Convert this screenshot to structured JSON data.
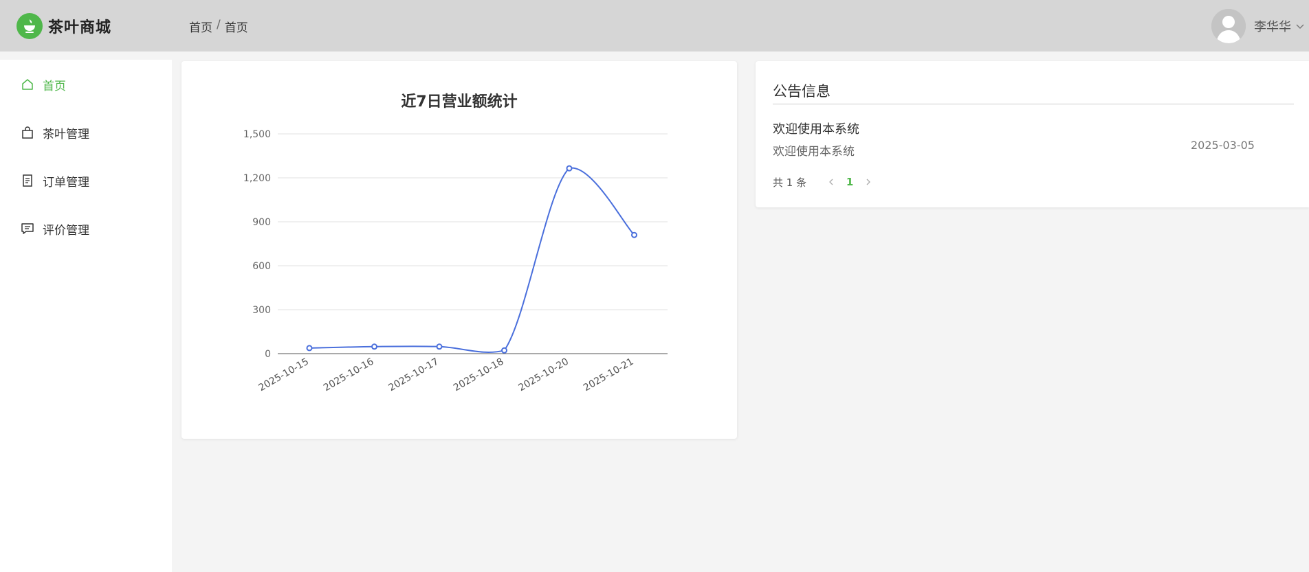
{
  "app": {
    "title": "茶叶商城",
    "accent_color": "#4fb74a",
    "logo_icon": "teacup-icon"
  },
  "header": {
    "breadcrumb": [
      "首页",
      "首页"
    ],
    "breadcrumb_separator": "/",
    "user": {
      "name": "李华华",
      "avatar_icon": "user-avatar-icon",
      "dropdown_icon": "chevron-down-icon"
    }
  },
  "sidebar": {
    "items": [
      {
        "label": "首页",
        "icon": "home-icon",
        "active": true
      },
      {
        "label": "茶叶管理",
        "icon": "shopping-bag-icon",
        "active": false
      },
      {
        "label": "订单管理",
        "icon": "document-icon",
        "active": false
      },
      {
        "label": "评价管理",
        "icon": "comment-icon",
        "active": false
      }
    ]
  },
  "notice": {
    "title": "公告信息",
    "items": [
      {
        "title": "欢迎使用本系统",
        "content": "欢迎使用本系统",
        "date": "2025-03-05"
      }
    ],
    "pagination": {
      "total_text": "共 1 条",
      "current_page": "1"
    }
  },
  "chart_data": {
    "type": "line",
    "title": "近7日营业额统计",
    "categories": [
      "2025-10-15",
      "2025-10-16",
      "2025-10-17",
      "2025-10-18",
      "2025-10-20",
      "2025-10-21"
    ],
    "series": [
      {
        "color": "#4a6fdc",
        "values": [
          38,
          48,
          48,
          22,
          1265,
          810
        ]
      }
    ],
    "ylim": [
      0,
      1500
    ],
    "yticks": [
      0,
      300,
      600,
      900,
      1200,
      1500
    ],
    "ytick_labels": [
      "0",
      "300",
      "600",
      "900",
      "1,200",
      "1,500"
    ],
    "xlabel": "",
    "ylabel": "",
    "grid": true,
    "smooth": true
  }
}
